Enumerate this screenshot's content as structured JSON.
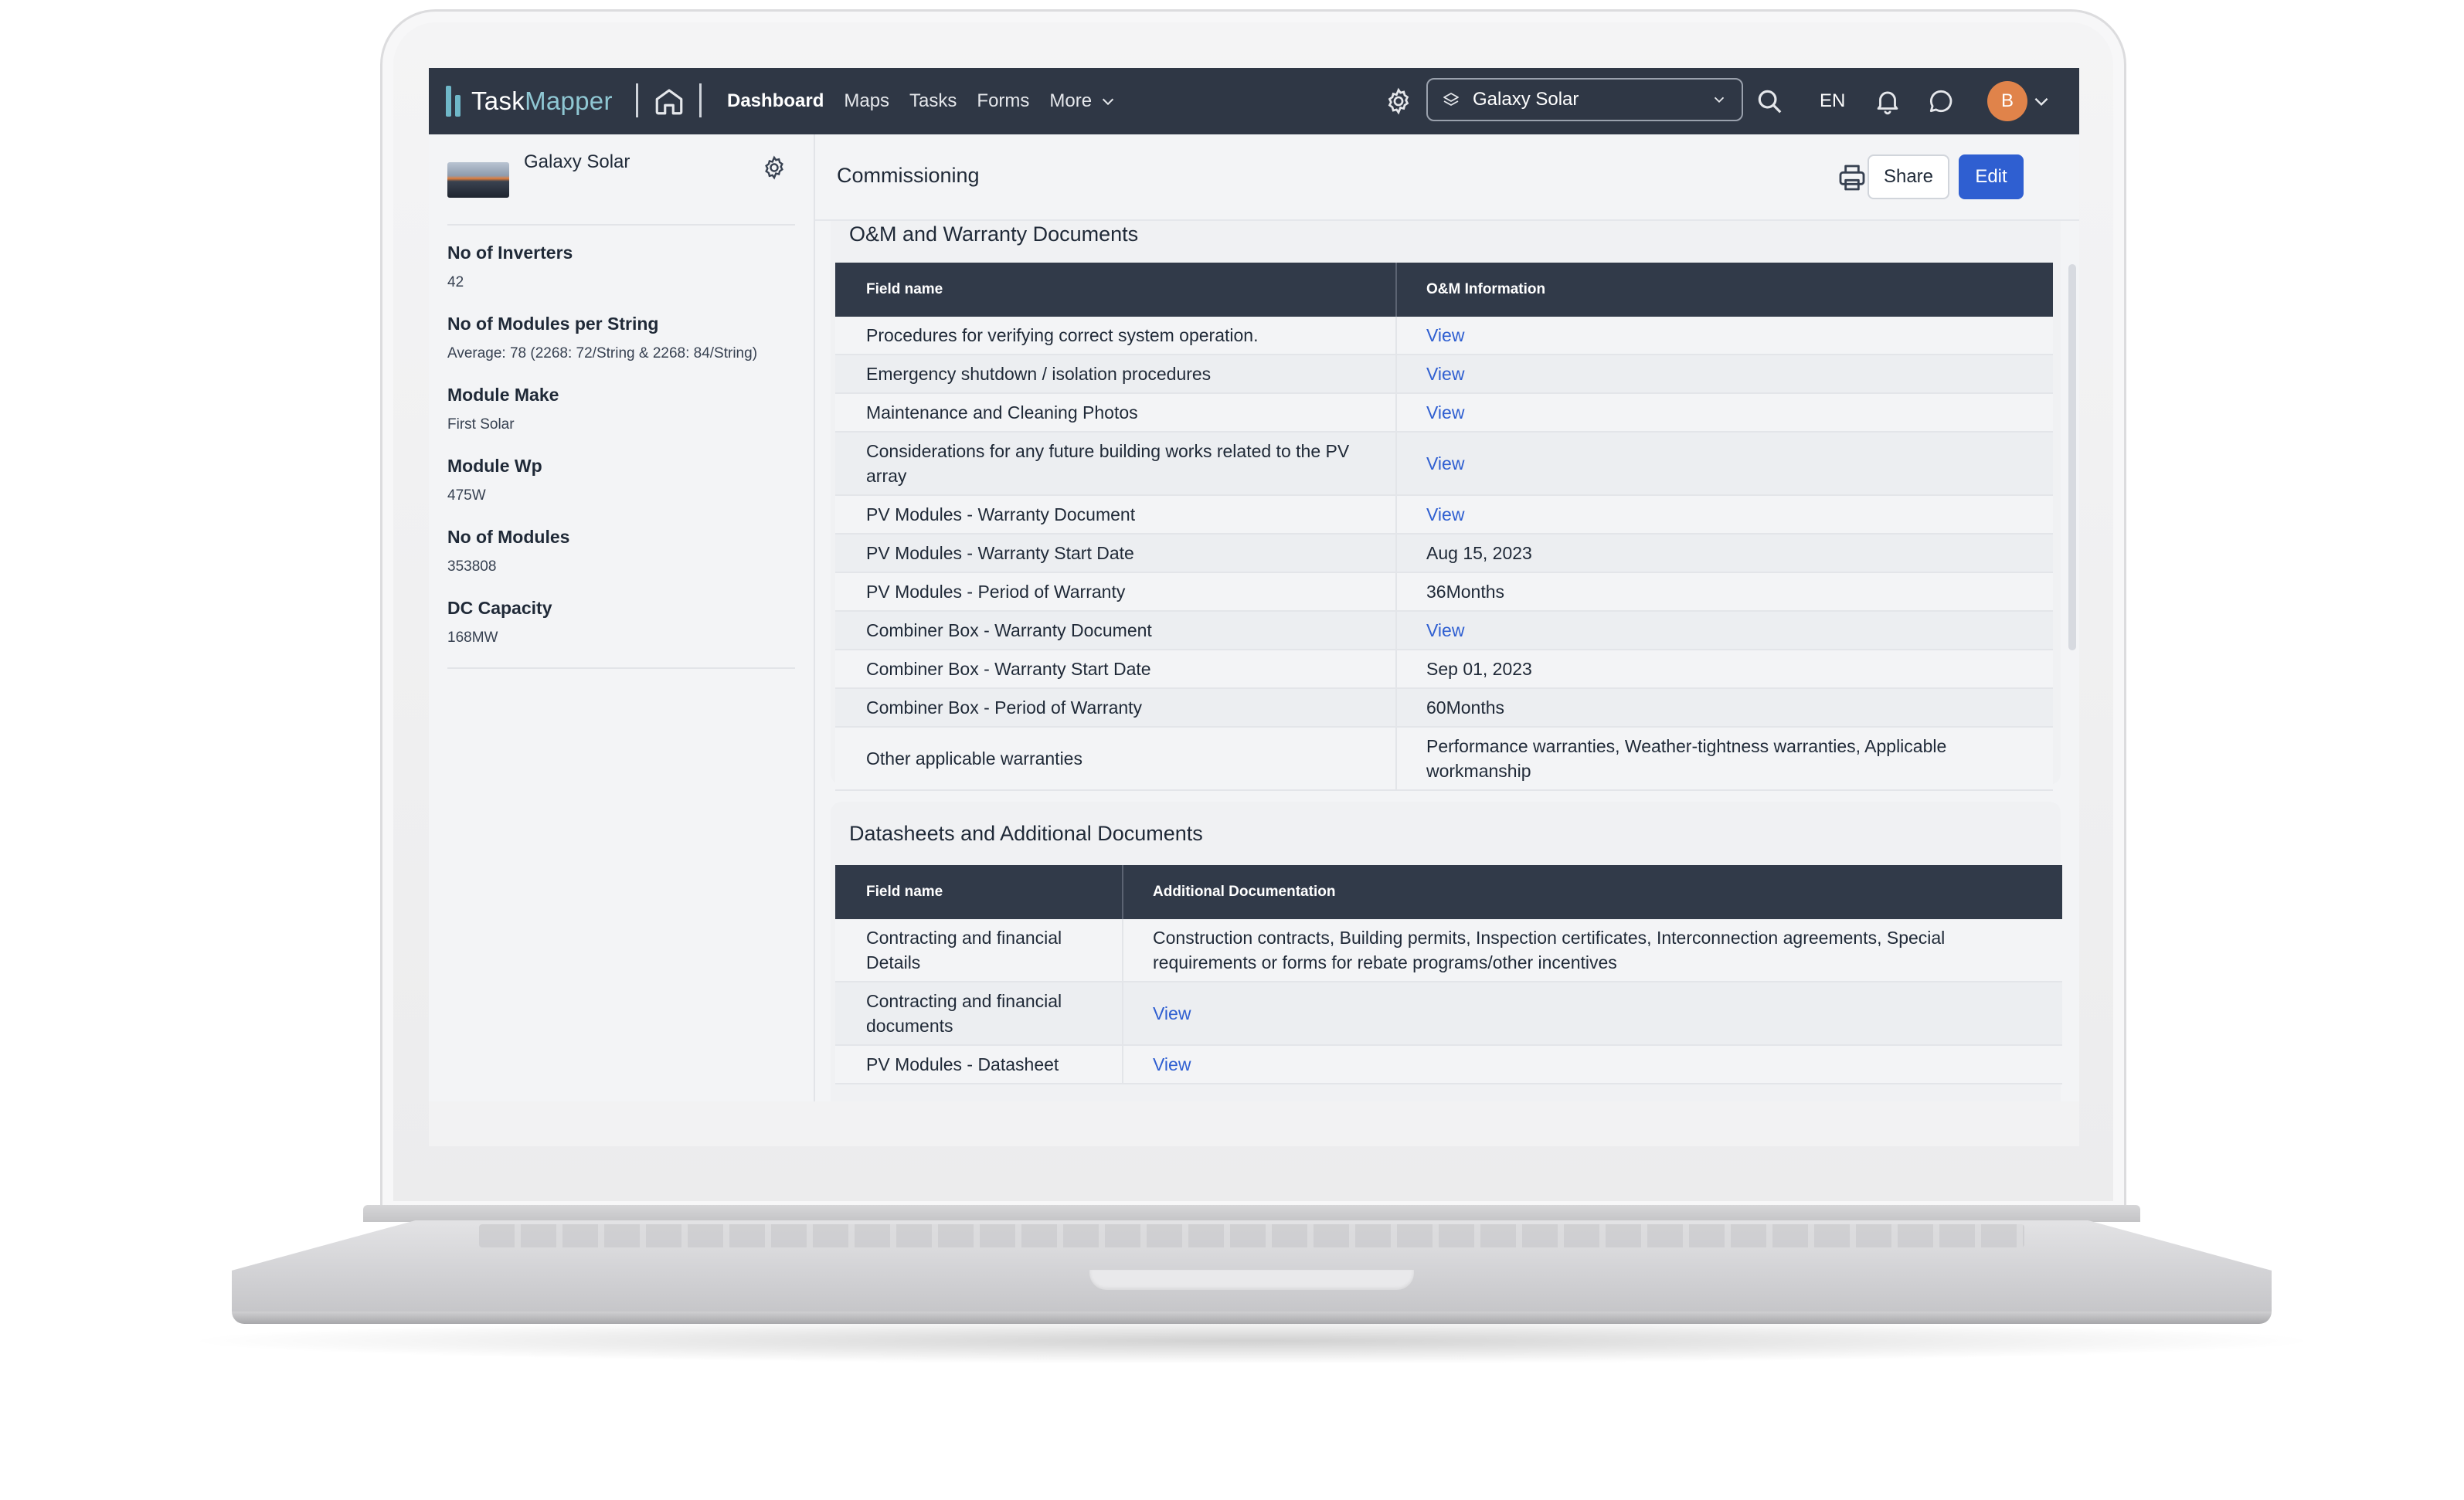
{
  "app": {
    "logo_prefix": "Task",
    "logo_suffix": "Mapper"
  },
  "nav": [
    {
      "label": "Dashboard",
      "active": true
    },
    {
      "label": "Maps",
      "active": false
    },
    {
      "label": "Tasks",
      "active": false
    },
    {
      "label": "Forms",
      "active": false
    },
    {
      "label": "More",
      "active": false
    }
  ],
  "topbar": {
    "project": "Galaxy Solar",
    "language": "EN",
    "avatar_initial": "B"
  },
  "colors": {
    "topbar": "#2f3745",
    "accent": "#2f5fd1",
    "avatar": "#e0834a",
    "table_header": "#313a49"
  },
  "sidebar": {
    "site_name": "Galaxy Solar",
    "attributes": [
      {
        "label": "No of Inverters",
        "value": "42"
      },
      {
        "label": "No of Modules per String",
        "value": "Average: 78 (2268: 72/String & 2268: 84/String)"
      },
      {
        "label": "Module Make",
        "value": "First Solar"
      },
      {
        "label": "Module Wp",
        "value": "475W"
      },
      {
        "label": "No of Modules",
        "value": "353808"
      },
      {
        "label": "DC Capacity",
        "value": "168MW"
      }
    ]
  },
  "page": {
    "title": "Commissioning",
    "share_label": "Share",
    "edit_label": "Edit"
  },
  "om_section": {
    "title": "O&M and Warranty Documents",
    "headers": [
      "Field name",
      "O&M Information"
    ],
    "rows": [
      {
        "field": "Procedures for verifying correct system operation.",
        "value": "View",
        "link": true
      },
      {
        "field": "Emergency shutdown / isolation procedures",
        "value": "View",
        "link": true
      },
      {
        "field": "Maintenance and Cleaning Photos",
        "value": "View",
        "link": true
      },
      {
        "field": "Considerations for any future building works related to the PV array",
        "value": "View",
        "link": true
      },
      {
        "field": "PV Modules - Warranty Document",
        "value": "View",
        "link": true
      },
      {
        "field": "PV Modules - Warranty Start Date",
        "value": "Aug 15, 2023",
        "link": false
      },
      {
        "field": "PV Modules - Period of Warranty",
        "value": "36Months",
        "link": false
      },
      {
        "field": "Combiner Box - Warranty Document",
        "value": "View",
        "link": true
      },
      {
        "field": "Combiner Box - Warranty Start Date",
        "value": "Sep 01, 2023",
        "link": false
      },
      {
        "field": "Combiner Box - Period of Warranty",
        "value": "60Months",
        "link": false
      },
      {
        "field": "Other applicable warranties",
        "value": "Performance warranties, Weather-tightness warranties, Applicable workmanship",
        "link": false
      }
    ]
  },
  "datasheet_section": {
    "title": "Datasheets and Additional Documents",
    "headers": [
      "Field name",
      "Additional Documentation"
    ],
    "rows": [
      {
        "field": "Contracting and financial Details",
        "value": "Construction contracts, Building permits, Inspection certificates, Interconnection agreements, Special requirements or forms for rebate programs/other incentives",
        "link": false
      },
      {
        "field": "Contracting and financial documents",
        "value": "View",
        "link": true
      },
      {
        "field": "PV Modules - Datasheet",
        "value": "View",
        "link": true
      }
    ]
  }
}
